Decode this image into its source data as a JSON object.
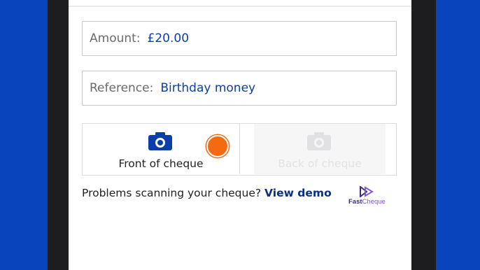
{
  "form": {
    "amount": {
      "label": "Amount:",
      "value": "£20.00"
    },
    "reference": {
      "label": "Reference:",
      "value": "Birthday money"
    }
  },
  "capture": {
    "front_label": "Front of cheque",
    "back_label": "Back of cheque",
    "icon": "camera-icon"
  },
  "help": {
    "text": "Problems scanning your cheque?",
    "link": "View demo"
  },
  "brand": {
    "part1": "Fast",
    "part2": "Cheque"
  },
  "colors": {
    "background": "#0a44bd",
    "accent": "#0b3ea8",
    "touch": "#f36a12"
  }
}
